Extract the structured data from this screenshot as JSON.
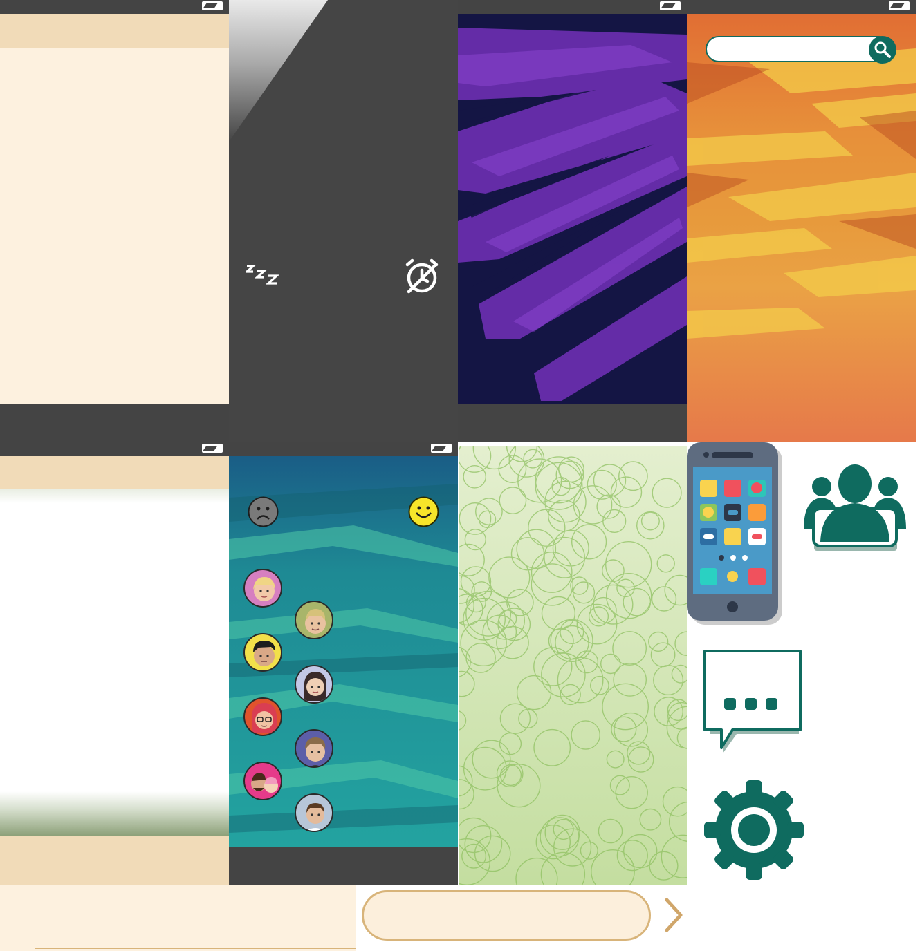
{
  "colors": {
    "status_bar": "#444444",
    "cream": "#fdf1df",
    "cream_header": "#f1dbb8",
    "teal_icon": "#0f6b5f",
    "pill_border": "#d8b47a",
    "chevron": "#d0a66a"
  },
  "icons": {
    "battery": "battery-icon",
    "sleep": "sleep-zzz-icon",
    "alarm_off": "alarm-off-icon",
    "search": "search-icon",
    "sad": "sad-face-icon",
    "happy": "happy-face-icon",
    "phone": "phone-apps-icon",
    "group": "group-people-icon",
    "chat": "chat-bubble-icon",
    "settings": "gear-icon",
    "next": "chevron-right-icon"
  },
  "search": {
    "placeholder": ""
  },
  "contacts": [
    {
      "name": "contact-blonde-girl"
    },
    {
      "name": "contact-blonde-boy"
    },
    {
      "name": "contact-dark-hair-boy"
    },
    {
      "name": "contact-long-hair-girl"
    },
    {
      "name": "contact-red-hair-glasses"
    },
    {
      "name": "contact-teen-boy"
    },
    {
      "name": "contact-couple"
    },
    {
      "name": "contact-man-shirt"
    }
  ],
  "input": {
    "placeholder": ""
  }
}
